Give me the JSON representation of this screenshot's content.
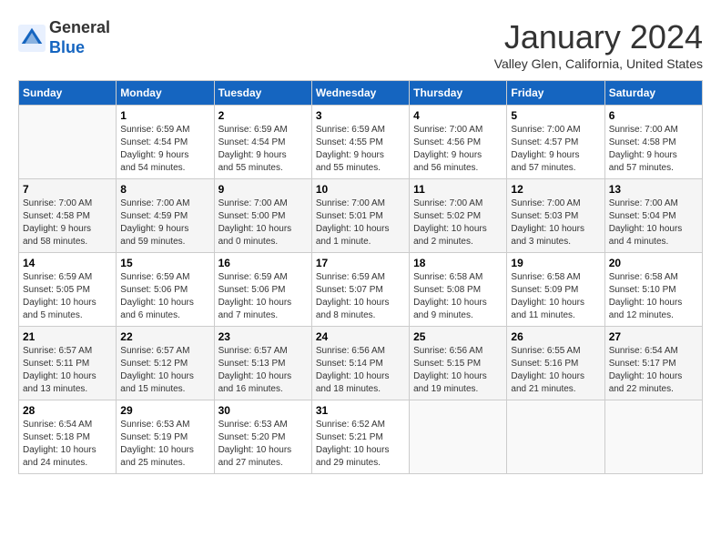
{
  "header": {
    "logo_general": "General",
    "logo_blue": "Blue",
    "month_title": "January 2024",
    "location": "Valley Glen, California, United States"
  },
  "weekdays": [
    "Sunday",
    "Monday",
    "Tuesday",
    "Wednesday",
    "Thursday",
    "Friday",
    "Saturday"
  ],
  "weeks": [
    [
      {
        "day": "",
        "info": ""
      },
      {
        "day": "1",
        "info": "Sunrise: 6:59 AM\nSunset: 4:54 PM\nDaylight: 9 hours\nand 54 minutes."
      },
      {
        "day": "2",
        "info": "Sunrise: 6:59 AM\nSunset: 4:54 PM\nDaylight: 9 hours\nand 55 minutes."
      },
      {
        "day": "3",
        "info": "Sunrise: 6:59 AM\nSunset: 4:55 PM\nDaylight: 9 hours\nand 55 minutes."
      },
      {
        "day": "4",
        "info": "Sunrise: 7:00 AM\nSunset: 4:56 PM\nDaylight: 9 hours\nand 56 minutes."
      },
      {
        "day": "5",
        "info": "Sunrise: 7:00 AM\nSunset: 4:57 PM\nDaylight: 9 hours\nand 57 minutes."
      },
      {
        "day": "6",
        "info": "Sunrise: 7:00 AM\nSunset: 4:58 PM\nDaylight: 9 hours\nand 57 minutes."
      }
    ],
    [
      {
        "day": "7",
        "info": "Sunrise: 7:00 AM\nSunset: 4:58 PM\nDaylight: 9 hours\nand 58 minutes."
      },
      {
        "day": "8",
        "info": "Sunrise: 7:00 AM\nSunset: 4:59 PM\nDaylight: 9 hours\nand 59 minutes."
      },
      {
        "day": "9",
        "info": "Sunrise: 7:00 AM\nSunset: 5:00 PM\nDaylight: 10 hours\nand 0 minutes."
      },
      {
        "day": "10",
        "info": "Sunrise: 7:00 AM\nSunset: 5:01 PM\nDaylight: 10 hours\nand 1 minute."
      },
      {
        "day": "11",
        "info": "Sunrise: 7:00 AM\nSunset: 5:02 PM\nDaylight: 10 hours\nand 2 minutes."
      },
      {
        "day": "12",
        "info": "Sunrise: 7:00 AM\nSunset: 5:03 PM\nDaylight: 10 hours\nand 3 minutes."
      },
      {
        "day": "13",
        "info": "Sunrise: 7:00 AM\nSunset: 5:04 PM\nDaylight: 10 hours\nand 4 minutes."
      }
    ],
    [
      {
        "day": "14",
        "info": "Sunrise: 6:59 AM\nSunset: 5:05 PM\nDaylight: 10 hours\nand 5 minutes."
      },
      {
        "day": "15",
        "info": "Sunrise: 6:59 AM\nSunset: 5:06 PM\nDaylight: 10 hours\nand 6 minutes."
      },
      {
        "day": "16",
        "info": "Sunrise: 6:59 AM\nSunset: 5:06 PM\nDaylight: 10 hours\nand 7 minutes."
      },
      {
        "day": "17",
        "info": "Sunrise: 6:59 AM\nSunset: 5:07 PM\nDaylight: 10 hours\nand 8 minutes."
      },
      {
        "day": "18",
        "info": "Sunrise: 6:58 AM\nSunset: 5:08 PM\nDaylight: 10 hours\nand 9 minutes."
      },
      {
        "day": "19",
        "info": "Sunrise: 6:58 AM\nSunset: 5:09 PM\nDaylight: 10 hours\nand 11 minutes."
      },
      {
        "day": "20",
        "info": "Sunrise: 6:58 AM\nSunset: 5:10 PM\nDaylight: 10 hours\nand 12 minutes."
      }
    ],
    [
      {
        "day": "21",
        "info": "Sunrise: 6:57 AM\nSunset: 5:11 PM\nDaylight: 10 hours\nand 13 minutes."
      },
      {
        "day": "22",
        "info": "Sunrise: 6:57 AM\nSunset: 5:12 PM\nDaylight: 10 hours\nand 15 minutes."
      },
      {
        "day": "23",
        "info": "Sunrise: 6:57 AM\nSunset: 5:13 PM\nDaylight: 10 hours\nand 16 minutes."
      },
      {
        "day": "24",
        "info": "Sunrise: 6:56 AM\nSunset: 5:14 PM\nDaylight: 10 hours\nand 18 minutes."
      },
      {
        "day": "25",
        "info": "Sunrise: 6:56 AM\nSunset: 5:15 PM\nDaylight: 10 hours\nand 19 minutes."
      },
      {
        "day": "26",
        "info": "Sunrise: 6:55 AM\nSunset: 5:16 PM\nDaylight: 10 hours\nand 21 minutes."
      },
      {
        "day": "27",
        "info": "Sunrise: 6:54 AM\nSunset: 5:17 PM\nDaylight: 10 hours\nand 22 minutes."
      }
    ],
    [
      {
        "day": "28",
        "info": "Sunrise: 6:54 AM\nSunset: 5:18 PM\nDaylight: 10 hours\nand 24 minutes."
      },
      {
        "day": "29",
        "info": "Sunrise: 6:53 AM\nSunset: 5:19 PM\nDaylight: 10 hours\nand 25 minutes."
      },
      {
        "day": "30",
        "info": "Sunrise: 6:53 AM\nSunset: 5:20 PM\nDaylight: 10 hours\nand 27 minutes."
      },
      {
        "day": "31",
        "info": "Sunrise: 6:52 AM\nSunset: 5:21 PM\nDaylight: 10 hours\nand 29 minutes."
      },
      {
        "day": "",
        "info": ""
      },
      {
        "day": "",
        "info": ""
      },
      {
        "day": "",
        "info": ""
      }
    ]
  ]
}
